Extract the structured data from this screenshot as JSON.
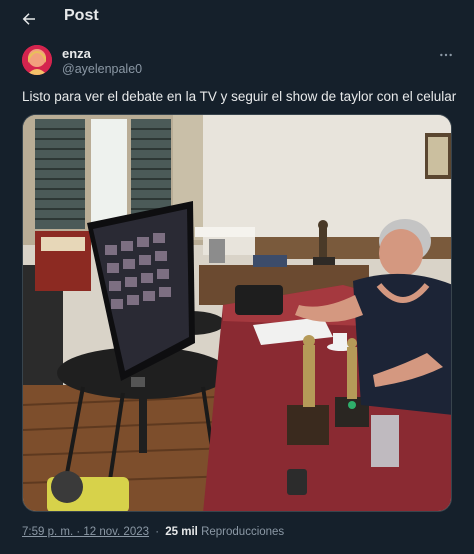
{
  "header": {
    "title": "Post"
  },
  "author": {
    "display_name": "enza",
    "handle": "@ayelenpale0"
  },
  "tweet": {
    "text": "Listo para ver el debate en la TV y seguir el show de taylor con el celular"
  },
  "meta": {
    "timestamp": "7:59 p. m. · 12 nov. 2023",
    "separator": "·",
    "views_count": "25 mil",
    "views_label": "Reproducciones"
  },
  "colors": {
    "background": "#15202b",
    "text": "#e7e9ea",
    "muted": "#8b98a5",
    "border": "#38444d"
  },
  "icons": {
    "back": "arrow-left-icon",
    "more": "more-horizontal-icon"
  }
}
